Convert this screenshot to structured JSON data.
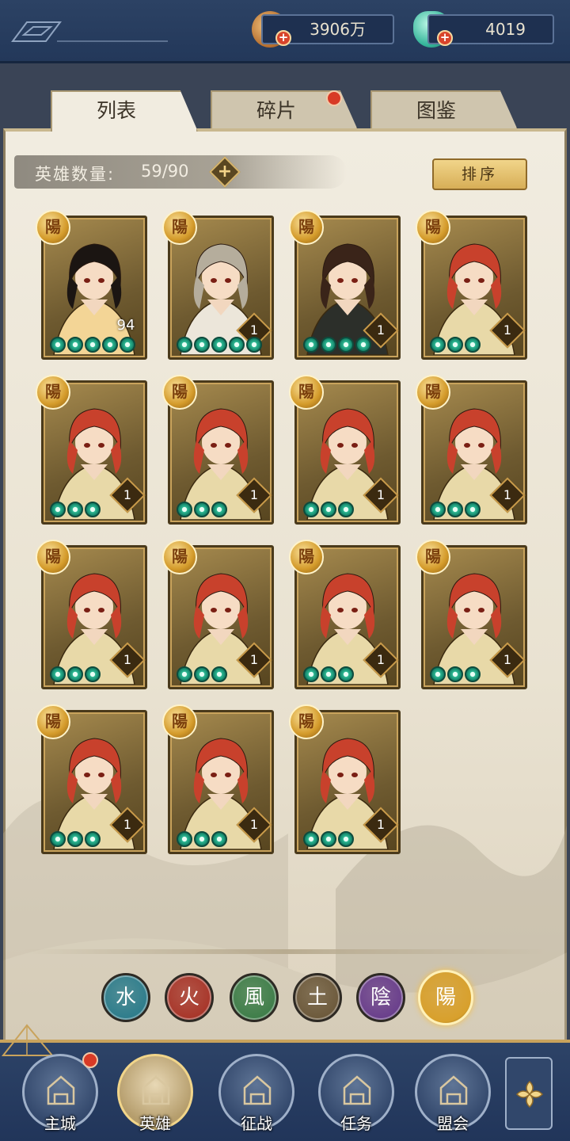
{
  "currency": {
    "coins": "3906万",
    "jade": "4019"
  },
  "tabs": [
    {
      "label": "列表",
      "active": true
    },
    {
      "label": "碎片",
      "active": false,
      "has_notice": true
    },
    {
      "label": "图鉴",
      "active": false
    }
  ],
  "hero_count": {
    "label": "英雄数量:",
    "value": "59/90"
  },
  "sort_label": "排序",
  "heroes": [
    {
      "faction": "陽",
      "level": "94",
      "stars": 5,
      "name_hint": "black-hair-fan-heroine"
    },
    {
      "faction": "陽",
      "level": "1",
      "stars": 5,
      "name_hint": "silver-hair-warrior"
    },
    {
      "faction": "陽",
      "level": "1",
      "stars": 4,
      "name_hint": "brown-hair-swordsman"
    },
    {
      "faction": "陽",
      "level": "1",
      "stars": 3,
      "name_hint": "red-hair-warrior"
    },
    {
      "faction": "陽",
      "level": "1",
      "stars": 3,
      "name_hint": "red-hair-warrior"
    },
    {
      "faction": "陽",
      "level": "1",
      "stars": 3,
      "name_hint": "red-hair-warrior"
    },
    {
      "faction": "陽",
      "level": "1",
      "stars": 3,
      "name_hint": "red-hair-warrior"
    },
    {
      "faction": "陽",
      "level": "1",
      "stars": 3,
      "name_hint": "red-hair-warrior"
    },
    {
      "faction": "陽",
      "level": "1",
      "stars": 3,
      "name_hint": "red-hair-warrior"
    },
    {
      "faction": "陽",
      "level": "1",
      "stars": 3,
      "name_hint": "red-hair-warrior"
    },
    {
      "faction": "陽",
      "level": "1",
      "stars": 3,
      "name_hint": "red-hair-warrior"
    },
    {
      "faction": "陽",
      "level": "1",
      "stars": 3,
      "name_hint": "red-hair-warrior"
    },
    {
      "faction": "陽",
      "level": "1",
      "stars": 3,
      "name_hint": "red-hair-warrior"
    },
    {
      "faction": "陽",
      "level": "1",
      "stars": 3,
      "name_hint": "red-hair-warrior"
    },
    {
      "faction": "陽",
      "level": "1",
      "stars": 3,
      "name_hint": "red-hair-warrior"
    }
  ],
  "elements": [
    {
      "glyph": "水",
      "color": "#2e7d8c",
      "active": false
    },
    {
      "glyph": "火",
      "color": "#a8362a",
      "active": false
    },
    {
      "glyph": "風",
      "color": "#3f7e4a",
      "active": false
    },
    {
      "glyph": "土",
      "color": "#6d5a3c",
      "active": false
    },
    {
      "glyph": "陰",
      "color": "#6a3f8c",
      "active": false
    },
    {
      "glyph": "陽",
      "color": "#d8a02c",
      "active": true
    }
  ],
  "nav": [
    {
      "label": "主城",
      "icon": "city-gate-icon",
      "active": false,
      "has_notice": true
    },
    {
      "label": "英雄",
      "icon": "hero-portrait-icon",
      "active": true
    },
    {
      "label": "征战",
      "icon": "battle-drum-icon",
      "active": false
    },
    {
      "label": "任务",
      "icon": "scroll-bell-icon",
      "active": false
    },
    {
      "label": "盟会",
      "icon": "pavilion-icon",
      "active": false
    }
  ]
}
